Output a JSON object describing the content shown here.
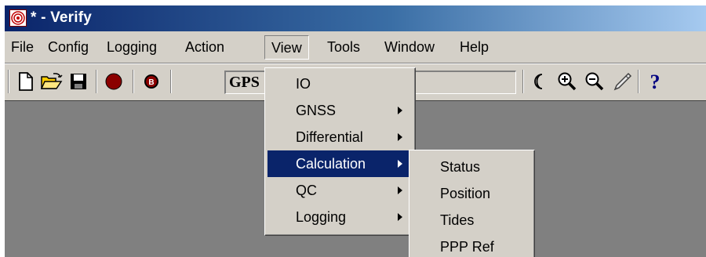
{
  "window": {
    "title": "* - Verify"
  },
  "menubar": {
    "items": [
      "File",
      "Config",
      "Logging",
      "Action",
      "View",
      "Tools",
      "Window",
      "Help"
    ]
  },
  "toolbar": {
    "source_combo_value": "GPS",
    "icons": [
      "new-file-icon",
      "open-folder-icon",
      "save-disk-icon",
      "record-icon",
      "record-b-icon",
      "moon-icon",
      "zoom-in-icon",
      "zoom-out-icon",
      "pencil-icon",
      "help-icon"
    ]
  },
  "view_menu": {
    "items": [
      "IO",
      "GNSS",
      "Differential",
      "Calculation",
      "QC",
      "Logging"
    ],
    "highlighted": "Calculation"
  },
  "calculation_submenu": {
    "items": [
      "Status",
      "Position",
      "Tides",
      "PPP Ref"
    ]
  },
  "colors": {
    "title_start": "#0a246a",
    "title_end": "#a6caf0",
    "highlight": "#0a246a",
    "face": "#d4d0c8",
    "workspace": "#808080",
    "record": "#8b0000"
  }
}
